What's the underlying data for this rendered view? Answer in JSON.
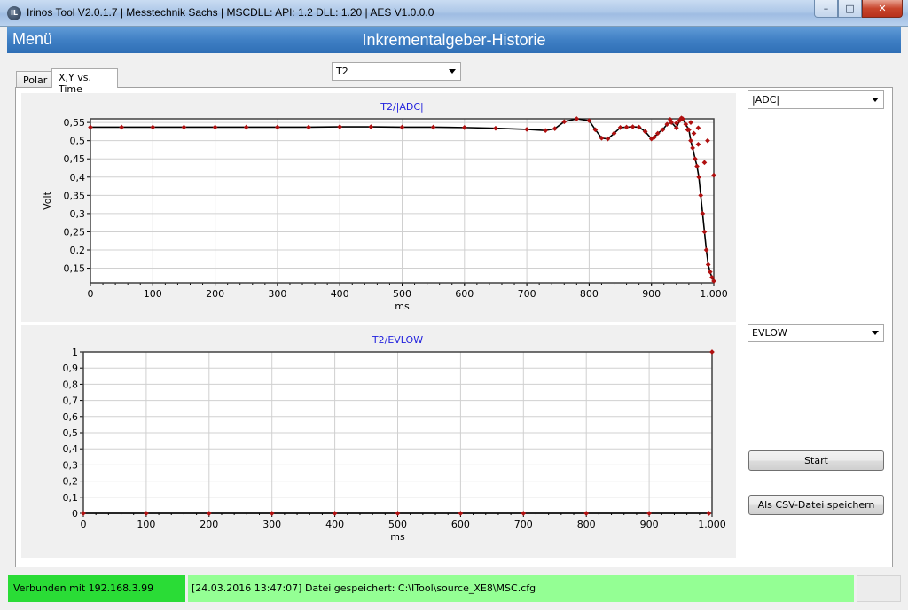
{
  "window": {
    "title": "Irinos Tool V2.0.1.7 | Messtechnik Sachs | MSCDLL: API: 1.2 DLL: 1.20 | AES V1.0.0.0",
    "icon_label": "IL",
    "min_glyph": "–",
    "max_glyph": "□",
    "close_glyph": "✕"
  },
  "header": {
    "menu_label": "Menü",
    "title": "Inkrementalgeber-Historie"
  },
  "tabs": [
    {
      "label": "Polar",
      "active": false
    },
    {
      "label": "X,Y vs. Time",
      "active": true
    }
  ],
  "channel_select": {
    "value": "T2"
  },
  "chart1_select": {
    "value": "|ADC|"
  },
  "chart2_select": {
    "value": "EVLOW"
  },
  "buttons": {
    "start": "Start",
    "save_csv": "Als CSV-Datei speichern"
  },
  "status": {
    "connection": "Verbunden mit 192.168.3.99",
    "message": "[24.03.2016 13:47:07] Datei gespeichert: C:\\ITool\\source_XE8\\MSC.cfg"
  },
  "colors": {
    "title_blue": "#2222dd",
    "series_line": "#000000",
    "series_marker": "#b01010",
    "connected_green": "#2adc36",
    "message_green": "#94ff94"
  },
  "chart_data": [
    {
      "type": "scatter",
      "title": "T2/|ADC|",
      "xlabel": "ms",
      "ylabel": "Volt",
      "xlim": [
        0,
        1000
      ],
      "ylim": [
        0.11,
        0.56
      ],
      "xticks": [
        0,
        100,
        200,
        300,
        400,
        500,
        600,
        700,
        800,
        900,
        1000
      ],
      "xtick_labels": [
        "0",
        "100",
        "200",
        "300",
        "400",
        "500",
        "600",
        "700",
        "800",
        "900",
        "1.000"
      ],
      "yticks": [
        0.15,
        0.2,
        0.25,
        0.3,
        0.35,
        0.4,
        0.45,
        0.5,
        0.55
      ],
      "ytick_labels": [
        "0,15",
        "0,2",
        "0,25",
        "0,3",
        "0,35",
        "0,4",
        "0,45",
        "0,5",
        "0,55"
      ],
      "grid": true,
      "series": [
        {
          "x": [
            0,
            50,
            100,
            150,
            200,
            250,
            300,
            350,
            400,
            450,
            500,
            550,
            600,
            650,
            700,
            730,
            745,
            760,
            780,
            800,
            810,
            820,
            830,
            840,
            850,
            860,
            870,
            880,
            890,
            900,
            905,
            910,
            918,
            925,
            932,
            940,
            945,
            950,
            955,
            960,
            963,
            966,
            970,
            973,
            976,
            979,
            982,
            985,
            988,
            991,
            994,
            997,
            1000
          ],
          "y": [
            0.537,
            0.537,
            0.537,
            0.537,
            0.537,
            0.537,
            0.537,
            0.537,
            0.538,
            0.538,
            0.537,
            0.537,
            0.536,
            0.534,
            0.531,
            0.528,
            0.533,
            0.552,
            0.56,
            0.555,
            0.53,
            0.507,
            0.505,
            0.52,
            0.536,
            0.537,
            0.538,
            0.537,
            0.525,
            0.505,
            0.51,
            0.52,
            0.53,
            0.545,
            0.55,
            0.535,
            0.555,
            0.56,
            0.545,
            0.53,
            0.5,
            0.48,
            0.45,
            0.43,
            0.4,
            0.35,
            0.3,
            0.25,
            0.2,
            0.16,
            0.14,
            0.125,
            0.115
          ]
        }
      ],
      "scatter_markers": [
        {
          "x": 930,
          "y": 0.558
        },
        {
          "x": 940,
          "y": 0.548
        },
        {
          "x": 948,
          "y": 0.562
        },
        {
          "x": 958,
          "y": 0.53
        },
        {
          "x": 963,
          "y": 0.55
        },
        {
          "x": 968,
          "y": 0.52
        },
        {
          "x": 975,
          "y": 0.535
        },
        {
          "x": 990,
          "y": 0.5
        },
        {
          "x": 1000,
          "y": 0.405
        },
        {
          "x": 985,
          "y": 0.44
        },
        {
          "x": 975,
          "y": 0.49
        }
      ]
    },
    {
      "type": "scatter",
      "title": "T2/EVLOW",
      "xlabel": "ms",
      "ylabel": "",
      "xlim": [
        0,
        1000
      ],
      "ylim": [
        0,
        1
      ],
      "xticks": [
        0,
        100,
        200,
        300,
        400,
        500,
        600,
        700,
        800,
        900,
        1000
      ],
      "xtick_labels": [
        "0",
        "100",
        "200",
        "300",
        "400",
        "500",
        "600",
        "700",
        "800",
        "900",
        "1.000"
      ],
      "yticks": [
        0,
        0.1,
        0.2,
        0.3,
        0.4,
        0.5,
        0.6,
        0.7,
        0.8,
        0.9,
        1
      ],
      "ytick_labels": [
        "0",
        "0,1",
        "0,2",
        "0,3",
        "0,4",
        "0,5",
        "0,6",
        "0,7",
        "0,8",
        "0,9",
        "1"
      ],
      "grid": true,
      "series": [
        {
          "x": [
            0,
            100,
            200,
            300,
            400,
            500,
            600,
            700,
            800,
            900,
            995
          ],
          "y": [
            0,
            0,
            0,
            0,
            0,
            0,
            0,
            0,
            0,
            0,
            0
          ]
        }
      ],
      "scatter_markers": [
        {
          "x": 1000,
          "y": 1
        }
      ]
    }
  ]
}
